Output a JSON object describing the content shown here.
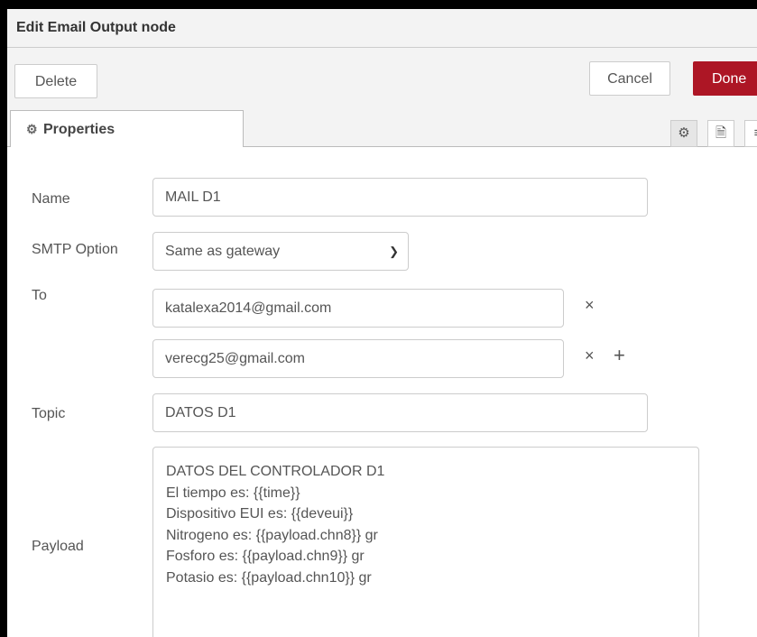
{
  "dialog": {
    "title": "Edit Email Output node"
  },
  "toolbar": {
    "delete_label": "Delete",
    "cancel_label": "Cancel",
    "done_label": "Done"
  },
  "tabs": {
    "active_label": "Properties",
    "icons": [
      "gear-icon",
      "document-icon",
      "layout-icon"
    ]
  },
  "form": {
    "name": {
      "label": "Name",
      "value": "MAIL D1"
    },
    "smtp": {
      "label": "SMTP Option",
      "value": "Same as gateway"
    },
    "to": {
      "label": "To",
      "recipients": [
        "katalexa2014@gmail.com",
        "verecg25@gmail.com"
      ]
    },
    "topic": {
      "label": "Topic",
      "value": "DATOS D1"
    },
    "payload": {
      "label": "Payload",
      "lines": [
        "DATOS DEL CONTROLADOR D1",
        "El tiempo es: {{time}}",
        "Dispositivo EUI es: {{deveui}}",
        "Nitrogeno es: {{payload.chn8}} gr",
        "Fosforo es: {{payload.chn9}} gr",
        "Potasio es: {{payload.chn10}} gr"
      ]
    }
  },
  "colors": {
    "done_button": "#ad1625",
    "header_bg": "#f3f3f3",
    "outer_frame": "#000000"
  }
}
